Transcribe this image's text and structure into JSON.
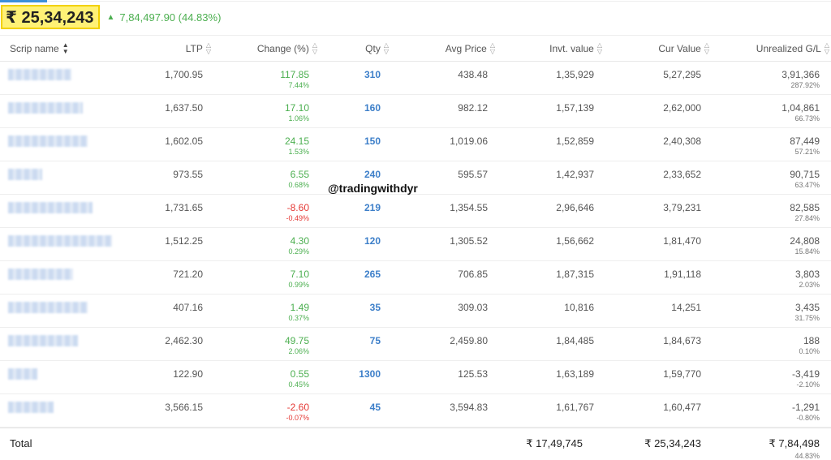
{
  "summary": {
    "total_value": "₹ 25,34,243",
    "pnl": "7,84,497.90 (44.83%)",
    "pnl_color": "#4caf50"
  },
  "columns": {
    "scrip": "Scrip name",
    "ltp": "LTP",
    "change": "Change (%)",
    "qty": "Qty",
    "avg": "Avg Price",
    "invt": "Invt. value",
    "cur": "Cur Value",
    "gl": "Unrealized G/L"
  },
  "rows": [
    {
      "ltp": "1,700.95",
      "chg": "117.85",
      "chg_pct": "7.44%",
      "dir": "pos",
      "qty": "310",
      "avg": "438.48",
      "invt": "1,35,929",
      "cur": "5,27,295",
      "gl": "3,91,366",
      "gl_pct": "287.92%"
    },
    {
      "ltp": "1,637.50",
      "chg": "17.10",
      "chg_pct": "1.06%",
      "dir": "pos",
      "qty": "160",
      "avg": "982.12",
      "invt": "1,57,139",
      "cur": "2,62,000",
      "gl": "1,04,861",
      "gl_pct": "66.73%"
    },
    {
      "ltp": "1,602.05",
      "chg": "24.15",
      "chg_pct": "1.53%",
      "dir": "pos",
      "qty": "150",
      "avg": "1,019.06",
      "invt": "1,52,859",
      "cur": "2,40,308",
      "gl": "87,449",
      "gl_pct": "57.21%"
    },
    {
      "ltp": "973.55",
      "chg": "6.55",
      "chg_pct": "0.68%",
      "dir": "pos",
      "qty": "240",
      "avg": "595.57",
      "invt": "1,42,937",
      "cur": "2,33,652",
      "gl": "90,715",
      "gl_pct": "63.47%"
    },
    {
      "ltp": "1,731.65",
      "chg": "-8.60",
      "chg_pct": "-0.49%",
      "dir": "neg",
      "qty": "219",
      "avg": "1,354.55",
      "invt": "2,96,646",
      "cur": "3,79,231",
      "gl": "82,585",
      "gl_pct": "27.84%"
    },
    {
      "ltp": "1,512.25",
      "chg": "4.30",
      "chg_pct": "0.29%",
      "dir": "pos",
      "qty": "120",
      "avg": "1,305.52",
      "invt": "1,56,662",
      "cur": "1,81,470",
      "gl": "24,808",
      "gl_pct": "15.84%"
    },
    {
      "ltp": "721.20",
      "chg": "7.10",
      "chg_pct": "0.99%",
      "dir": "pos",
      "qty": "265",
      "avg": "706.85",
      "invt": "1,87,315",
      "cur": "1,91,118",
      "gl": "3,803",
      "gl_pct": "2.03%"
    },
    {
      "ltp": "407.16",
      "chg": "1.49",
      "chg_pct": "0.37%",
      "dir": "pos",
      "qty": "35",
      "avg": "309.03",
      "invt": "10,816",
      "cur": "14,251",
      "gl": "3,435",
      "gl_pct": "31.75%"
    },
    {
      "ltp": "2,462.30",
      "chg": "49.75",
      "chg_pct": "2.06%",
      "dir": "pos",
      "qty": "75",
      "avg": "2,459.80",
      "invt": "1,84,485",
      "cur": "1,84,673",
      "gl": "188",
      "gl_pct": "0.10%"
    },
    {
      "ltp": "122.90",
      "chg": "0.55",
      "chg_pct": "0.45%",
      "dir": "pos",
      "qty": "1300",
      "avg": "125.53",
      "invt": "1,63,189",
      "cur": "1,59,770",
      "gl": "-3,419",
      "gl_pct": "-2.10%"
    },
    {
      "ltp": "3,566.15",
      "chg": "-2.60",
      "chg_pct": "-0.07%",
      "dir": "neg",
      "qty": "45",
      "avg": "3,594.83",
      "invt": "1,61,767",
      "cur": "1,60,477",
      "gl": "-1,291",
      "gl_pct": "-0.80%"
    }
  ],
  "footer": {
    "label": "Total",
    "invt": "₹ 17,49,745",
    "cur": "₹ 25,34,243",
    "gl": "₹ 7,84,498",
    "gl_pct": "44.83%"
  },
  "watermark": "@tradingwithdyr"
}
